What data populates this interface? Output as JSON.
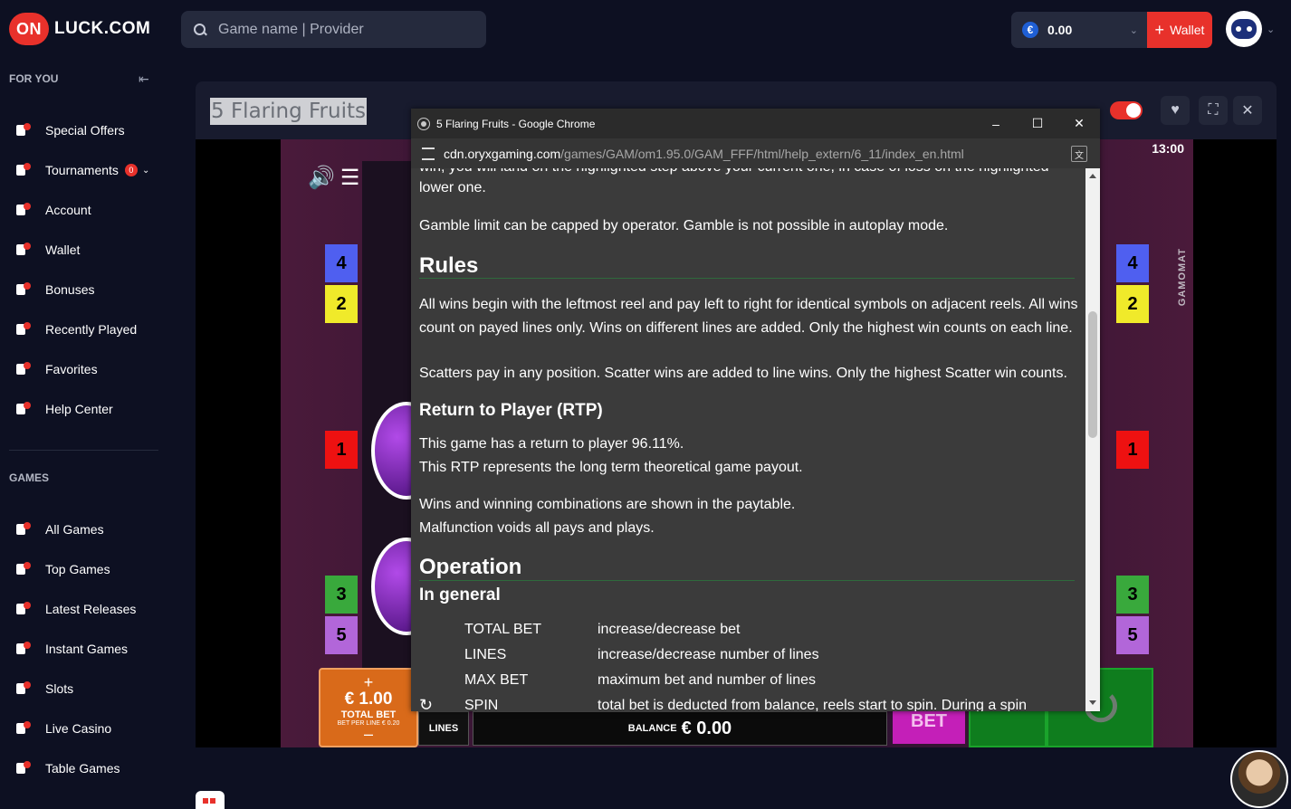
{
  "header": {
    "logo_badge": "ON",
    "logo_text": "LUCK.COM",
    "search_placeholder": "Game name | Provider",
    "balance": "0.00",
    "currency_symbol": "€",
    "wallet_label": "Wallet"
  },
  "sidebar": {
    "for_you_label": "FOR YOU",
    "games_label": "GAMES",
    "for_you_items": [
      {
        "label": "Special Offers",
        "icon": "megaphone-icon"
      },
      {
        "label": "Tournaments",
        "icon": "trophy-icon",
        "badge": "0"
      },
      {
        "label": "Account",
        "icon": "user-icon"
      },
      {
        "label": "Wallet",
        "icon": "wallet-icon"
      },
      {
        "label": "Bonuses",
        "icon": "money-bag-icon"
      },
      {
        "label": "Recently Played",
        "icon": "clock-icon"
      },
      {
        "label": "Favorites",
        "icon": "bookmark-icon"
      },
      {
        "label": "Help Center",
        "icon": "headset-icon"
      }
    ],
    "games_items": [
      {
        "label": "All Games",
        "icon": "cards-icon"
      },
      {
        "label": "Top Games",
        "icon": "diamond-icon"
      },
      {
        "label": "Latest Releases",
        "icon": "rocket-icon"
      },
      {
        "label": "Instant Games",
        "icon": "lightning-icon"
      },
      {
        "label": "Slots",
        "icon": "cherries-icon"
      },
      {
        "label": "Live Casino",
        "icon": "roulette-icon"
      },
      {
        "label": "Table Games",
        "icon": "playing-card-icon"
      }
    ]
  },
  "game": {
    "title": "5 Flaring Fruits",
    "clock": "13:00",
    "provider_mark": "GAMOMAT",
    "left_markers": [
      "4",
      "2",
      "1",
      "3",
      "5"
    ],
    "right_markers": [
      "4",
      "2",
      "1",
      "3",
      "5"
    ],
    "total_bet_amount": "€ 1.00",
    "total_bet_label": "TOTAL BET",
    "bet_per_line": "BET PER LINE € 0.20",
    "lines_label": "LINES",
    "balance_label": "BALANCE",
    "balance_value": "€ 0.00",
    "bet_label": "BET"
  },
  "popup": {
    "window_title": "5 Flaring Fruits - Google Chrome",
    "url_domain": "cdn.oryxgaming.com",
    "url_path": "/games/GAM/om1.95.0/GAM_FFF/html/help_extern/6_11/index_en.html",
    "cut_line": "win, you will land on the highlighted step above your current one, in case of loss on the highlighted",
    "intro_line": "lower one.",
    "gamble_limit": "Gamble limit can be capped by operator. Gamble is not possible in autoplay mode.",
    "rules_heading": "Rules",
    "rules_p1": "All wins begin with the leftmost reel and pay left to right for identical symbols on adjacent reels. All wins count on payed lines only. Wins on different lines are added. Only the highest win counts on each line.",
    "rules_p2": "Scatters pay in any position. Scatter wins are added to line wins. Only the highest Scatter win counts.",
    "rtp_heading": "Return to Player (RTP)",
    "rtp_p1": "This game has a return to player 96.11%.",
    "rtp_p2": "This RTP represents the long term theoretical game payout.",
    "wins_p1": "Wins and winning combinations are shown in the paytable.",
    "wins_p2": "Malfunction voids all pays and plays.",
    "operation_heading": "Operation",
    "general_heading": "In general",
    "operations": [
      {
        "key": "TOTAL BET",
        "value": "increase/decrease bet"
      },
      {
        "key": "LINES",
        "value": "increase/decrease number of lines"
      },
      {
        "key": "MAX BET",
        "value": "maximum bet and number of lines"
      },
      {
        "key": "SPIN",
        "value": "total bet is deducted from balance, reels start to spin. During a spin"
      }
    ]
  },
  "colors": {
    "accent": "#e8312b",
    "page_bg": "#0d1022",
    "panel_bg": "#252a3d"
  }
}
